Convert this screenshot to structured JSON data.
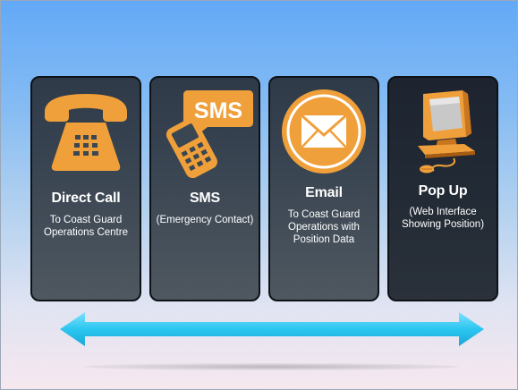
{
  "colors": {
    "accent": "#f0a03a",
    "card_bg": "#3b4653",
    "arrow": "#2bc6f0",
    "text": "#ffffff"
  },
  "cards": [
    {
      "title": "Direct Call",
      "description": "To Coast Guard Operations Centre",
      "icon": "telephone-icon"
    },
    {
      "title": "SMS",
      "description": "(Emergency Contact)",
      "icon": "sms-phone-icon",
      "icon_text": "SMS"
    },
    {
      "title": "Email",
      "description": "To Coast Guard Operations with Position Data",
      "icon": "envelope-icon"
    },
    {
      "title": "Pop Up",
      "description": "(Web Interface Showing Position)",
      "icon": "computer-icon"
    }
  ],
  "arrow": {
    "icon": "double-arrow-icon"
  }
}
